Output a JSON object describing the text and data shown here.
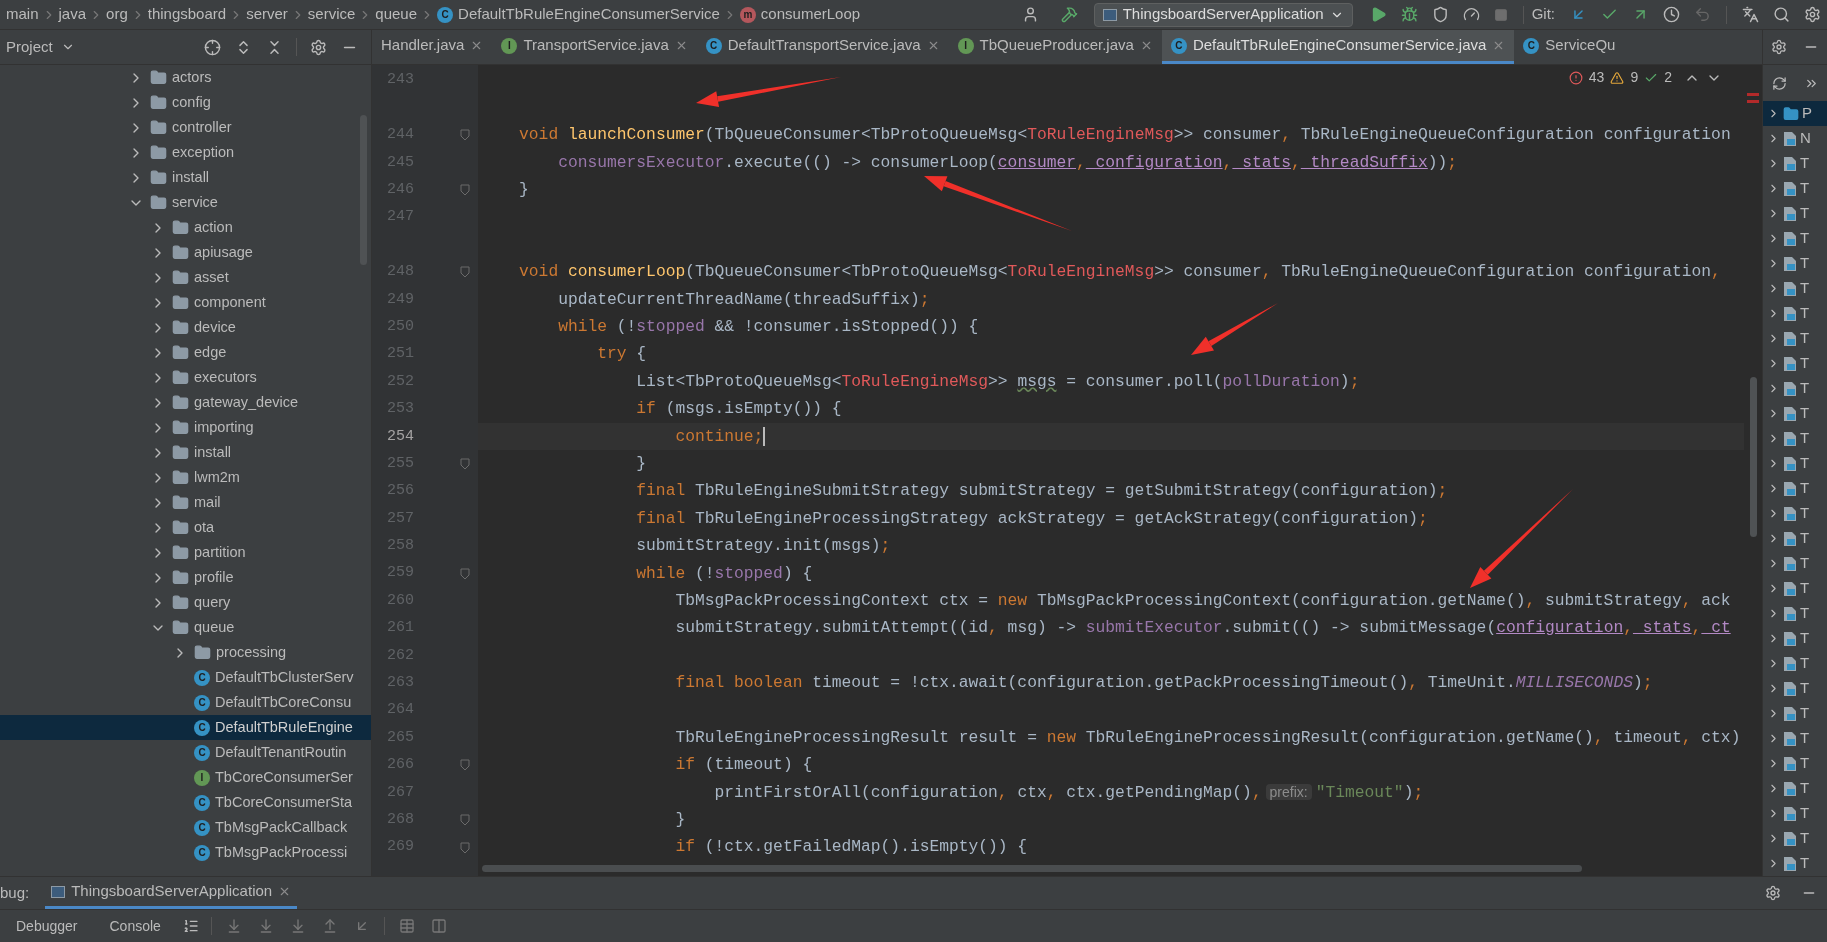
{
  "breadcrumb": [
    {
      "label": "main",
      "kind": "folder"
    },
    {
      "label": "java",
      "kind": "folder"
    },
    {
      "label": "org",
      "kind": "folder"
    },
    {
      "label": "thingsboard",
      "kind": "folder"
    },
    {
      "label": "server",
      "kind": "folder"
    },
    {
      "label": "service",
      "kind": "folder"
    },
    {
      "label": "queue",
      "kind": "folder"
    },
    {
      "label": "DefaultTbRuleEngineConsumerService",
      "kind": "class",
      "badge": "C"
    },
    {
      "label": "consumerLoop",
      "kind": "method",
      "badge": "m"
    }
  ],
  "run_config": "ThingsboardServerApplication",
  "git_label": "Git:",
  "project_panel": {
    "title": "Project",
    "tree": [
      {
        "label": "actors",
        "kind": "folder",
        "expanded": false,
        "selected": false
      },
      {
        "label": "config",
        "kind": "folder",
        "expanded": false,
        "selected": false
      },
      {
        "label": "controller",
        "kind": "folder",
        "expanded": false,
        "selected": false
      },
      {
        "label": "exception",
        "kind": "folder",
        "expanded": false,
        "selected": false
      },
      {
        "label": "install",
        "kind": "folder",
        "expanded": false,
        "selected": false
      },
      {
        "label": "service",
        "kind": "folder",
        "expanded": true,
        "selected": false,
        "children": [
          {
            "label": "action",
            "kind": "folder",
            "expanded": false,
            "selected": false
          },
          {
            "label": "apiusage",
            "kind": "folder",
            "expanded": false,
            "selected": false
          },
          {
            "label": "asset",
            "kind": "folder",
            "expanded": false,
            "selected": false
          },
          {
            "label": "component",
            "kind": "folder",
            "expanded": false,
            "selected": false
          },
          {
            "label": "device",
            "kind": "folder",
            "expanded": false,
            "selected": false
          },
          {
            "label": "edge",
            "kind": "folder",
            "expanded": false,
            "selected": false
          },
          {
            "label": "executors",
            "kind": "folder",
            "expanded": false,
            "selected": false
          },
          {
            "label": "gateway_device",
            "kind": "folder",
            "expanded": false,
            "selected": false
          },
          {
            "label": "importing",
            "kind": "folder",
            "expanded": false,
            "selected": false
          },
          {
            "label": "install",
            "kind": "folder",
            "expanded": false,
            "selected": false
          },
          {
            "label": "lwm2m",
            "kind": "folder",
            "expanded": false,
            "selected": false
          },
          {
            "label": "mail",
            "kind": "folder",
            "expanded": false,
            "selected": false
          },
          {
            "label": "ota",
            "kind": "folder",
            "expanded": false,
            "selected": false
          },
          {
            "label": "partition",
            "kind": "folder",
            "expanded": false,
            "selected": false
          },
          {
            "label": "profile",
            "kind": "folder",
            "expanded": false,
            "selected": false
          },
          {
            "label": "query",
            "kind": "folder",
            "expanded": false,
            "selected": false
          },
          {
            "label": "queue",
            "kind": "folder",
            "expanded": true,
            "selected": false,
            "children": [
              {
                "label": "processing",
                "kind": "folder",
                "expanded": false,
                "selected": false
              },
              {
                "label": "DefaultTbClusterServ",
                "kind": "class",
                "badge": "C",
                "selected": false
              },
              {
                "label": "DefaultTbCoreConsu",
                "kind": "class",
                "badge": "C",
                "selected": false
              },
              {
                "label": "DefaultTbRuleEngine",
                "kind": "class",
                "badge": "C",
                "selected": true
              },
              {
                "label": "DefaultTenantRoutin",
                "kind": "class",
                "badge": "C",
                "selected": false
              },
              {
                "label": "TbCoreConsumerSer",
                "kind": "interface",
                "badge": "I",
                "selected": false
              },
              {
                "label": "TbCoreConsumerSta",
                "kind": "class",
                "badge": "C",
                "selected": false
              },
              {
                "label": "TbMsgPackCallback",
                "kind": "class",
                "badge": "C",
                "selected": false
              },
              {
                "label": "TbMsgPackProcessi",
                "kind": "class",
                "badge": "C",
                "selected": false
              }
            ]
          }
        ]
      }
    ]
  },
  "editor_tabs": [
    {
      "label": "Handler.java",
      "kind": "plain",
      "closable": true,
      "selected": false
    },
    {
      "label": "TransportService.java",
      "kind": "interface",
      "badge": "I",
      "closable": true,
      "selected": false
    },
    {
      "label": "DefaultTransportService.java",
      "kind": "class",
      "badge": "C",
      "closable": true,
      "selected": false
    },
    {
      "label": "TbQueueProducer.java",
      "kind": "interface",
      "badge": "I",
      "closable": true,
      "selected": false
    },
    {
      "label": "DefaultTbRuleEngineConsumerService.java",
      "kind": "class",
      "badge": "C",
      "closable": true,
      "selected": true
    },
    {
      "label": "ServiceQu",
      "kind": "class",
      "badge": "C",
      "closable": false,
      "selected": false
    }
  ],
  "editor": {
    "inspections": {
      "errors": "43",
      "warnings": "9",
      "checks": "2"
    },
    "lines": [
      {
        "number": "243",
        "fold": false,
        "current": false
      },
      {
        "number": "244",
        "fold": true,
        "current": false,
        "tokens": [
          {
            "kind": "keyword",
            "text": "    void"
          },
          {
            "kind": "decl",
            "text": " launchConsumer"
          },
          {
            "kind": "plain",
            "text": "(TbQueueConsumer<TbProtoQueueMsg<"
          },
          {
            "kind": "generic",
            "text": "ToRuleEngineMsg"
          },
          {
            "kind": "plain",
            "text": ">> consumer"
          },
          {
            "kind": "keyword",
            "text": ","
          },
          {
            "kind": "plain",
            "text": " TbRuleEngineQueueConfiguration configuration"
          }
        ]
      },
      {
        "number": "245",
        "fold": false,
        "current": false,
        "tokens": [
          {
            "kind": "field",
            "text": "        consumersExecutor"
          },
          {
            "kind": "plain",
            "text": ".execute(() -> consumerLoop("
          },
          {
            "kind": "param",
            "text": "consumer"
          },
          {
            "kind": "keyword",
            "text": ","
          },
          {
            "kind": "param",
            "text": " configuration"
          },
          {
            "kind": "keyword",
            "text": ","
          },
          {
            "kind": "param",
            "text": " stats"
          },
          {
            "kind": "keyword",
            "text": ","
          },
          {
            "kind": "param",
            "text": " threadSuffix"
          },
          {
            "kind": "plain",
            "text": "))"
          },
          {
            "kind": "keyword",
            "text": ";"
          }
        ]
      },
      {
        "number": "246",
        "fold": true,
        "current": false,
        "tokens": [
          {
            "kind": "plain",
            "text": "    }"
          }
        ]
      },
      {
        "number": "247",
        "fold": false,
        "current": false
      },
      {
        "number": "248",
        "fold": true,
        "current": false,
        "tokens": [
          {
            "kind": "keyword",
            "text": "    void"
          },
          {
            "kind": "decl",
            "text": " consumerLoop"
          },
          {
            "kind": "plain",
            "text": "(TbQueueConsumer<TbProtoQueueMsg<"
          },
          {
            "kind": "generic",
            "text": "ToRuleEngineMsg"
          },
          {
            "kind": "plain",
            "text": ">> consumer"
          },
          {
            "kind": "keyword",
            "text": ","
          },
          {
            "kind": "plain",
            "text": " TbRuleEngineQueueConfiguration configuration"
          },
          {
            "kind": "keyword",
            "text": ","
          }
        ]
      },
      {
        "number": "249",
        "fold": false,
        "current": false,
        "tokens": [
          {
            "kind": "plain",
            "text": "        updateCurrentThreadName(threadSuffix)"
          },
          {
            "kind": "keyword",
            "text": ";"
          }
        ]
      },
      {
        "number": "250",
        "fold": false,
        "current": false,
        "tokens": [
          {
            "kind": "keyword",
            "text": "        while"
          },
          {
            "kind": "plain",
            "text": " (!"
          },
          {
            "kind": "field",
            "text": "stopped"
          },
          {
            "kind": "plain",
            "text": " && !consumer.isStopped()) {"
          }
        ]
      },
      {
        "number": "251",
        "fold": false,
        "current": false,
        "tokens": [
          {
            "kind": "keyword",
            "text": "            try"
          },
          {
            "kind": "plain",
            "text": " {"
          }
        ]
      },
      {
        "number": "252",
        "fold": false,
        "current": false,
        "tokens": [
          {
            "kind": "plain",
            "text": "                List<TbProtoQueueMsg<"
          },
          {
            "kind": "generic",
            "text": "ToRuleEngineMsg"
          },
          {
            "kind": "plain",
            "text": ">> "
          },
          {
            "kind": "warned",
            "text": "msgs"
          },
          {
            "kind": "plain",
            "text": " = consumer.poll("
          },
          {
            "kind": "field",
            "text": "pollDuration"
          },
          {
            "kind": "plain",
            "text": ")"
          },
          {
            "kind": "keyword",
            "text": ";"
          }
        ]
      },
      {
        "number": "253",
        "fold": false,
        "current": false,
        "tokens": [
          {
            "kind": "keyword",
            "text": "                if"
          },
          {
            "kind": "plain",
            "text": " (msgs.isEmpty()) {"
          }
        ]
      },
      {
        "number": "254",
        "fold": false,
        "current": true,
        "tokens": [
          {
            "kind": "keyword",
            "text": "                    continue;"
          }
        ]
      },
      {
        "number": "255",
        "fold": true,
        "current": false,
        "tokens": [
          {
            "kind": "plain",
            "text": "                }"
          }
        ]
      },
      {
        "number": "256",
        "fold": false,
        "current": false,
        "tokens": [
          {
            "kind": "keyword",
            "text": "                final"
          },
          {
            "kind": "plain",
            "text": " TbRuleEngineSubmitStrategy submitStrategy = getSubmitStrategy(configuration)"
          },
          {
            "kind": "keyword",
            "text": ";"
          }
        ]
      },
      {
        "number": "257",
        "fold": false,
        "current": false,
        "tokens": [
          {
            "kind": "keyword",
            "text": "                final"
          },
          {
            "kind": "plain",
            "text": " TbRuleEngineProcessingStrategy ackStrategy = getAckStrategy(configuration)"
          },
          {
            "kind": "keyword",
            "text": ";"
          }
        ]
      },
      {
        "number": "258",
        "fold": false,
        "current": false,
        "tokens": [
          {
            "kind": "plain",
            "text": "                submitStrategy.init(msgs)"
          },
          {
            "kind": "keyword",
            "text": ";"
          }
        ]
      },
      {
        "number": "259",
        "fold": true,
        "current": false,
        "tokens": [
          {
            "kind": "keyword",
            "text": "                while"
          },
          {
            "kind": "plain",
            "text": " (!"
          },
          {
            "kind": "field",
            "text": "stopped"
          },
          {
            "kind": "plain",
            "text": ") {"
          }
        ]
      },
      {
        "number": "260",
        "fold": false,
        "current": false,
        "tokens": [
          {
            "kind": "plain",
            "text": "                    TbMsgPackProcessingContext ctx = "
          },
          {
            "kind": "keyword",
            "text": "new"
          },
          {
            "kind": "plain",
            "text": " TbMsgPackProcessingContext(configuration.getName()"
          },
          {
            "kind": "keyword",
            "text": ","
          },
          {
            "kind": "plain",
            "text": " submitStrategy"
          },
          {
            "kind": "keyword",
            "text": ","
          },
          {
            "kind": "plain",
            "text": " ack"
          }
        ]
      },
      {
        "number": "261",
        "fold": false,
        "current": false,
        "tokens": [
          {
            "kind": "plain",
            "text": "                    submitStrategy.submitAttempt((id"
          },
          {
            "kind": "keyword",
            "text": ","
          },
          {
            "kind": "plain",
            "text": " msg) -> "
          },
          {
            "kind": "field",
            "text": "submitExecutor"
          },
          {
            "kind": "plain",
            "text": ".submit(() -> submitMessage("
          },
          {
            "kind": "param",
            "text": "configuration"
          },
          {
            "kind": "keyword",
            "text": ","
          },
          {
            "kind": "param",
            "text": " stats"
          },
          {
            "kind": "keyword",
            "text": ","
          },
          {
            "kind": "param",
            "text": " ct"
          }
        ]
      },
      {
        "number": "262",
        "fold": false,
        "current": false
      },
      {
        "number": "263",
        "fold": false,
        "current": false,
        "tokens": [
          {
            "kind": "keyword",
            "text": "                    final boolean"
          },
          {
            "kind": "plain",
            "text": " timeout = !ctx.await(configuration.getPackProcessingTimeout()"
          },
          {
            "kind": "keyword",
            "text": ","
          },
          {
            "kind": "plain",
            "text": " TimeUnit."
          },
          {
            "kind": "constant",
            "text": "MILLISECONDS"
          },
          {
            "kind": "plain",
            "text": ")"
          },
          {
            "kind": "keyword",
            "text": ";"
          }
        ]
      },
      {
        "number": "264",
        "fold": false,
        "current": false
      },
      {
        "number": "265",
        "fold": false,
        "current": false,
        "tokens": [
          {
            "kind": "plain",
            "text": "                    TbRuleEngineProcessingResult result = "
          },
          {
            "kind": "keyword",
            "text": "new"
          },
          {
            "kind": "plain",
            "text": " TbRuleEngineProcessingResult(configuration.getName()"
          },
          {
            "kind": "keyword",
            "text": ","
          },
          {
            "kind": "plain",
            "text": " timeout"
          },
          {
            "kind": "keyword",
            "text": ","
          },
          {
            "kind": "plain",
            "text": " ctx)"
          }
        ]
      },
      {
        "number": "266",
        "fold": true,
        "current": false,
        "tokens": [
          {
            "kind": "keyword",
            "text": "                    if"
          },
          {
            "kind": "plain",
            "text": " (timeout) {"
          }
        ]
      },
      {
        "number": "267",
        "fold": false,
        "current": false,
        "tokens": [
          {
            "kind": "plain",
            "text": "                        printFirstOrAll(configuration"
          },
          {
            "kind": "keyword",
            "text": ","
          },
          {
            "kind": "plain",
            "text": " ctx"
          },
          {
            "kind": "keyword",
            "text": ","
          },
          {
            "kind": "plain",
            "text": " ctx.getPendingMap()"
          },
          {
            "kind": "keyword",
            "text": ","
          },
          {
            "kind": "hint",
            "text": "prefix:"
          },
          {
            "kind": "string",
            "text": "\"Timeout\""
          },
          {
            "kind": "plain",
            "text": ")"
          },
          {
            "kind": "keyword",
            "text": ";"
          }
        ]
      },
      {
        "number": "268",
        "fold": true,
        "current": false,
        "tokens": [
          {
            "kind": "plain",
            "text": "                    }"
          }
        ]
      },
      {
        "number": "269",
        "fold": true,
        "current": false,
        "tokens": [
          {
            "kind": "keyword",
            "text": "                    if"
          },
          {
            "kind": "plain",
            "text": " (!ctx.getFailedMap().isEmpty()) {"
          }
        ]
      }
    ]
  },
  "structure_panel": {
    "items": [
      {
        "label": "P",
        "kind": "module"
      },
      {
        "label": "N",
        "kind": "file"
      },
      {
        "label": "T",
        "kind": "file"
      },
      {
        "label": "T",
        "kind": "file"
      },
      {
        "label": "T",
        "kind": "file"
      },
      {
        "label": "T",
        "kind": "file"
      },
      {
        "label": "T",
        "kind": "file"
      },
      {
        "label": "T",
        "kind": "file"
      },
      {
        "label": "T",
        "kind": "file"
      },
      {
        "label": "T",
        "kind": "file"
      },
      {
        "label": "T",
        "kind": "file"
      },
      {
        "label": "T",
        "kind": "file"
      },
      {
        "label": "T",
        "kind": "file"
      },
      {
        "label": "T",
        "kind": "file"
      },
      {
        "label": "T",
        "kind": "file"
      },
      {
        "label": "T",
        "kind": "file"
      },
      {
        "label": "T",
        "kind": "file"
      },
      {
        "label": "T",
        "kind": "file"
      },
      {
        "label": "T",
        "kind": "file"
      },
      {
        "label": "T",
        "kind": "file"
      },
      {
        "label": "T",
        "kind": "file"
      },
      {
        "label": "T",
        "kind": "file"
      },
      {
        "label": "T",
        "kind": "file"
      },
      {
        "label": "T",
        "kind": "file"
      },
      {
        "label": "T",
        "kind": "file"
      },
      {
        "label": "T",
        "kind": "file"
      },
      {
        "label": "T",
        "kind": "file"
      },
      {
        "label": "T",
        "kind": "file"
      },
      {
        "label": "T",
        "kind": "file"
      },
      {
        "label": "T",
        "kind": "file"
      },
      {
        "label": "T",
        "kind": "file"
      }
    ]
  },
  "debug_bar": {
    "label": "bug:",
    "tab": "ThingsboardServerApplication",
    "tools": [
      {
        "label": "Debugger"
      },
      {
        "label": "Console"
      }
    ]
  }
}
